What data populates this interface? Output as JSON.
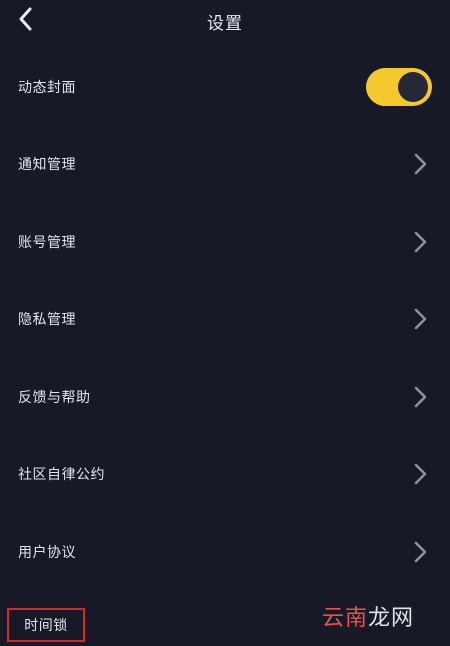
{
  "header": {
    "title": "设置"
  },
  "settings": {
    "items": [
      {
        "label": "动态封面",
        "control": "toggle",
        "toggle_on": true
      },
      {
        "label": "通知管理",
        "control": "chevron"
      },
      {
        "label": "账号管理",
        "control": "chevron"
      },
      {
        "label": "隐私管理",
        "control": "chevron"
      },
      {
        "label": "反馈与帮助",
        "control": "chevron"
      },
      {
        "label": "社区自律公约",
        "control": "chevron"
      },
      {
        "label": "用户协议",
        "control": "chevron"
      },
      {
        "label": "时间锁",
        "control": "none",
        "highlighted": true
      }
    ]
  },
  "watermark": {
    "part1": "云南",
    "part2": "龙网"
  },
  "colors": {
    "background": "#171a26",
    "toggle_on": "#f5c82d",
    "highlight_box": "#d8262b",
    "chevron": "#8e909b"
  }
}
